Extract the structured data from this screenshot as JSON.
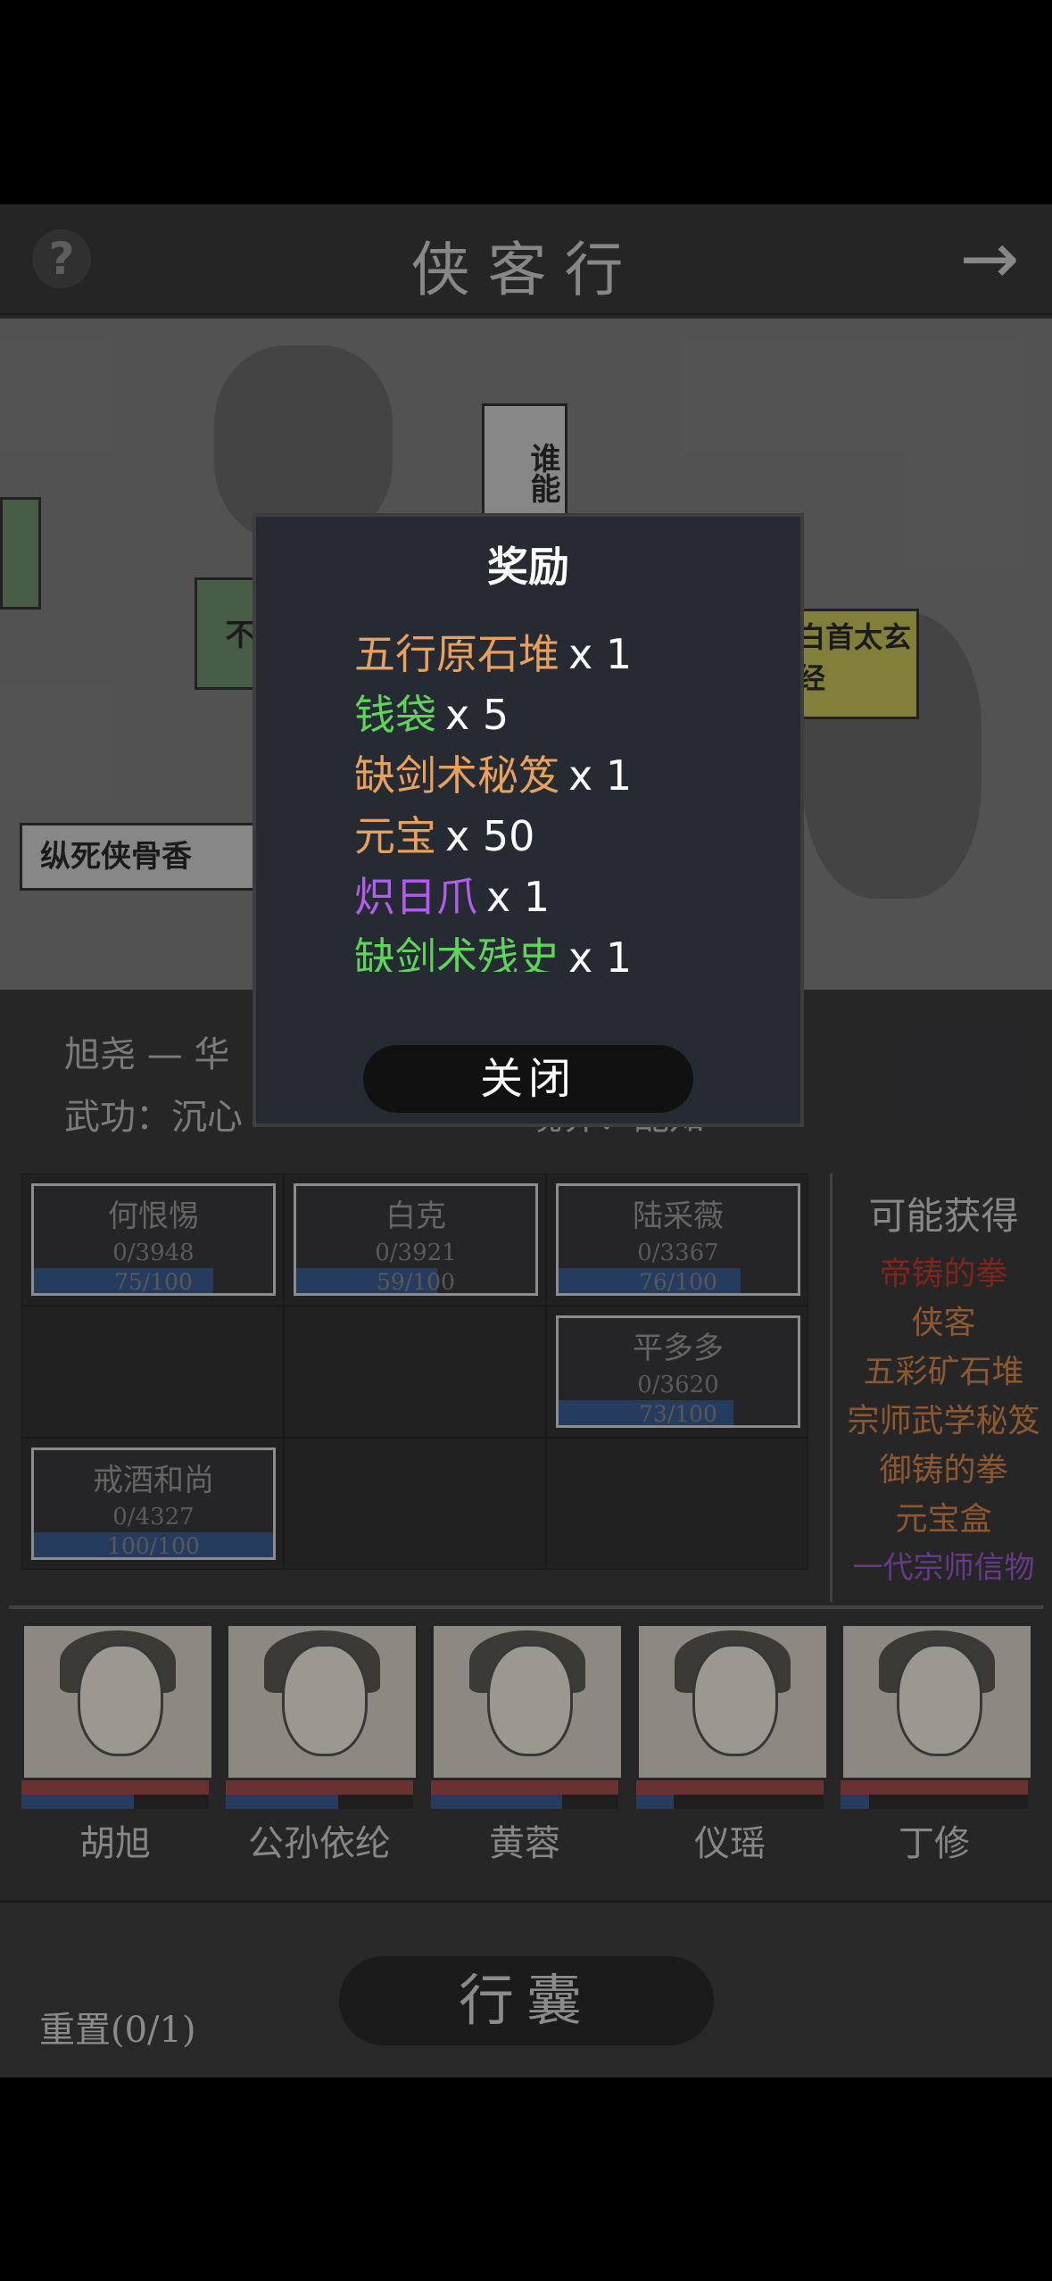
{
  "header": {
    "title": "侠客行",
    "help_icon": "?",
    "next_icon": "→"
  },
  "map": {
    "signs": [
      "谁能",
      "不",
      "纵死侠骨香",
      "白首太玄经"
    ]
  },
  "character": {
    "name": "旭尧 — 华",
    "martial": "武功：沉心",
    "realm": "境界：配知"
  },
  "enemies": [
    {
      "name": "何恨惕",
      "progress": "0/3948",
      "bar": "75/100",
      "fill": 0.75
    },
    {
      "name": "白克",
      "progress": "0/3921",
      "bar": "59/100",
      "fill": 0.59
    },
    {
      "name": "陆采薇",
      "progress": "0/3367",
      "bar": "76/100",
      "fill": 0.76
    },
    {
      "name": "平多多",
      "progress": "0/3620",
      "bar": "73/100",
      "fill": 0.73
    },
    {
      "name": "戒酒和尚",
      "progress": "0/4327",
      "bar": "100/100",
      "fill": 1.0
    }
  ],
  "possible": {
    "header": "可能获得",
    "items": [
      {
        "label": "帝铸的拳",
        "color": "#c0392b"
      },
      {
        "label": "侠客",
        "color": "#d9884a"
      },
      {
        "label": "五彩矿石堆",
        "color": "#d9884a"
      },
      {
        "label": "宗师武学秘笈",
        "color": "#d9884a"
      },
      {
        "label": "御铸的拳",
        "color": "#d9884a"
      },
      {
        "label": "元宝盒",
        "color": "#d9884a"
      },
      {
        "label": "一代宗师信物",
        "color": "#9b59d0"
      }
    ]
  },
  "heroes": [
    {
      "name": "胡旭",
      "mp": 0.6
    },
    {
      "name": "公孙依纶",
      "mp": 0.6
    },
    {
      "name": "黄蓉",
      "mp": 0.7
    },
    {
      "name": "仪瑶",
      "mp": 0.2
    },
    {
      "name": "丁修",
      "mp": 0.15
    }
  ],
  "bottom": {
    "bag": "行囊",
    "reset": "重置(0/1)"
  },
  "modal": {
    "title": "奖励",
    "rewards": [
      {
        "name": "五行原石堆",
        "qty": "x 1",
        "color": "#e8a05a"
      },
      {
        "name": "钱袋",
        "qty": "x 5",
        "color": "#5fd35a"
      },
      {
        "name": "缺剑术秘笈",
        "qty": "x 1",
        "color": "#e8a05a"
      },
      {
        "name": "元宝",
        "qty": "x 50",
        "color": "#e8a05a"
      },
      {
        "name": "炽日爪",
        "qty": "x 1",
        "color": "#b25cf0"
      },
      {
        "name": "缺剑术残史",
        "qty": "x 1",
        "color": "#5fd35a"
      }
    ],
    "close": "关闭"
  }
}
